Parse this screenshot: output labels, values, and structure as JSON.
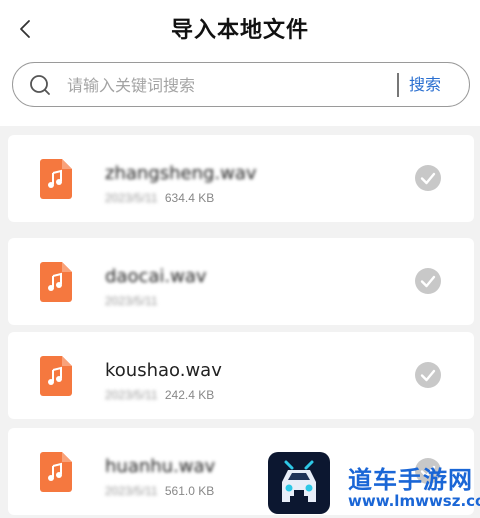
{
  "header": {
    "title": "导入本地文件",
    "back_icon": "chevron-left-icon"
  },
  "search": {
    "placeholder": "请输入关键词搜索",
    "value": "",
    "button_label": "搜索",
    "icon": "search-icon"
  },
  "files": [
    {
      "name": "zhangsheng.wav",
      "date": "2023/5/11",
      "size": "634.4 KB",
      "selected": false
    },
    {
      "name": "daocai.wav",
      "date": "2023/5/11",
      "size": "",
      "selected": false
    },
    {
      "name": "koushao.wav",
      "date": "2023/5/11",
      "size": "242.4 KB",
      "selected": false
    },
    {
      "name": "huanhu.wav",
      "date": "2023/5/11",
      "size": "561.0 KB",
      "selected": false
    }
  ],
  "colors": {
    "file_icon": "#f5783f",
    "accent": "#2a6fd0",
    "check": "#c8c8c8",
    "watermark": "#1a66d6"
  },
  "watermark": {
    "title": "道车手游网",
    "url": "www.lmwwsz.com"
  }
}
